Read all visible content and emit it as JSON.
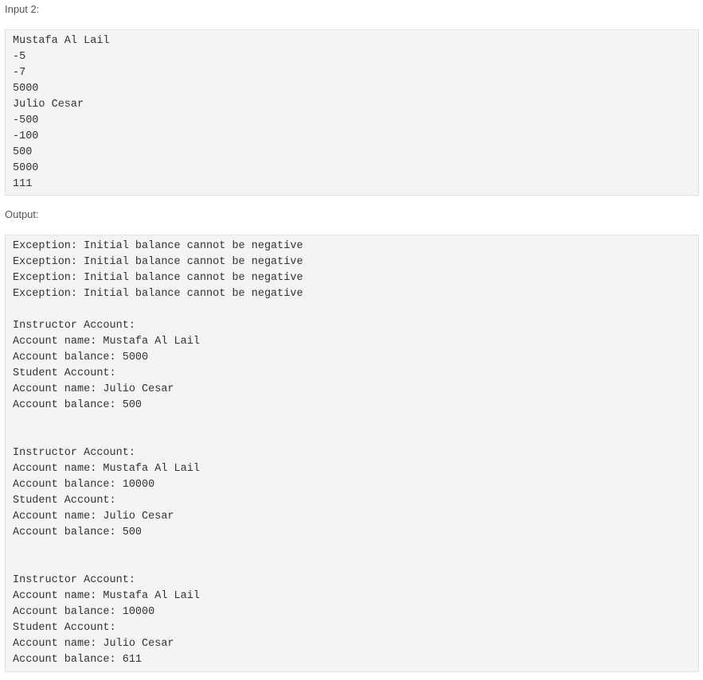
{
  "input": {
    "label": "Input 2:",
    "lines": [
      "Mustafa Al Lail",
      "-5",
      "-7",
      "5000",
      "Julio Cesar",
      "-500",
      "-100",
      "500",
      "5000",
      "111"
    ]
  },
  "output": {
    "label": "Output:",
    "lines": [
      "Exception: Initial balance cannot be negative",
      "Exception: Initial balance cannot be negative",
      "Exception: Initial balance cannot be negative",
      "Exception: Initial balance cannot be negative",
      "",
      "Instructor Account:",
      "Account name: Mustafa Al Lail",
      "Account balance: 5000",
      "Student Account:",
      "Account name: Julio Cesar",
      "Account balance: 500",
      "",
      "",
      "Instructor Account:",
      "Account name: Mustafa Al Lail",
      "Account balance: 10000",
      "Student Account:",
      "Account name: Julio Cesar",
      "Account balance: 500",
      "",
      "",
      "Instructor Account:",
      "Account name: Mustafa Al Lail",
      "Account balance: 10000",
      "Student Account:",
      "Account name: Julio Cesar",
      "Account balance: 611"
    ]
  }
}
